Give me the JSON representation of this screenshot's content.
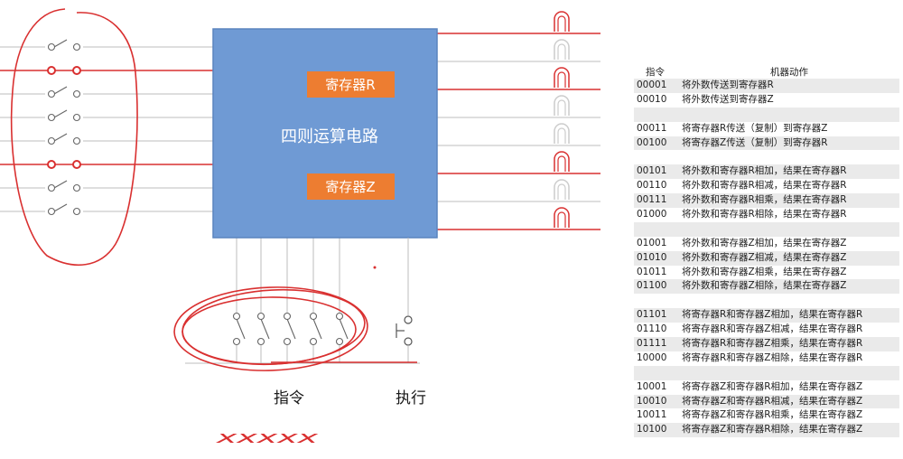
{
  "diagram": {
    "circuit_title": "四则运算电路",
    "register_r_label": "寄存器R",
    "register_z_label": "寄存器Z",
    "instruction_label": "指令",
    "execute_label": "执行",
    "scribble_text": "xxxxx",
    "input_switches_closed": [
      false,
      true,
      false,
      false,
      false,
      true,
      false,
      false
    ],
    "output_lamps_on": [
      true,
      false,
      true,
      false,
      false,
      true,
      false,
      true
    ],
    "colors": {
      "chip": "#6f9ad4",
      "chip_border": "#5a84be",
      "register": "#ed7d31",
      "wire": "#bdbdbd",
      "annotation": "#d93030"
    }
  },
  "table": {
    "headers": [
      "指令",
      "机器动作"
    ],
    "rows": [
      [
        "00001",
        "将外数传送到寄存器R"
      ],
      [
        "00010",
        "将外数传送到寄存器Z"
      ],
      [
        "",
        ""
      ],
      [
        "00011",
        "将寄存器R传送（复制）到寄存器Z"
      ],
      [
        "00100",
        "将寄存器Z传送（复制）到寄存器R"
      ],
      [
        "",
        ""
      ],
      [
        "00101",
        "将外数和寄存器R相加，结果在寄存器R"
      ],
      [
        "00110",
        "将外数和寄存器R相减，结果在寄存器R"
      ],
      [
        "00111",
        "将外数和寄存器R相乘，结果在寄存器R"
      ],
      [
        "01000",
        "将外数和寄存器R相除，结果在寄存器R"
      ],
      [
        "",
        ""
      ],
      [
        "01001",
        "将外数和寄存器Z相加，结果在寄存器Z"
      ],
      [
        "01010",
        "将外数和寄存器Z相减，结果在寄存器Z"
      ],
      [
        "01011",
        "将外数和寄存器Z相乘，结果在寄存器Z"
      ],
      [
        "01100",
        "将外数和寄存器Z相除，结果在寄存器Z"
      ],
      [
        "",
        ""
      ],
      [
        "01101",
        "将寄存器R和寄存器Z相加，结果在寄存器R"
      ],
      [
        "01110",
        "将寄存器R和寄存器Z相减，结果在寄存器R"
      ],
      [
        "01111",
        "将寄存器R和寄存器Z相乘，结果在寄存器R"
      ],
      [
        "10000",
        "将寄存器R和寄存器Z相除，结果在寄存器R"
      ],
      [
        "",
        ""
      ],
      [
        "10001",
        "将寄存器Z和寄存器R相加，结果在寄存器Z"
      ],
      [
        "10010",
        "将寄存器Z和寄存器R相减，结果在寄存器Z"
      ],
      [
        "10011",
        "将寄存器Z和寄存器R相乘，结果在寄存器Z"
      ],
      [
        "10100",
        "将寄存器Z和寄存器R相除，结果在寄存器Z"
      ]
    ]
  }
}
